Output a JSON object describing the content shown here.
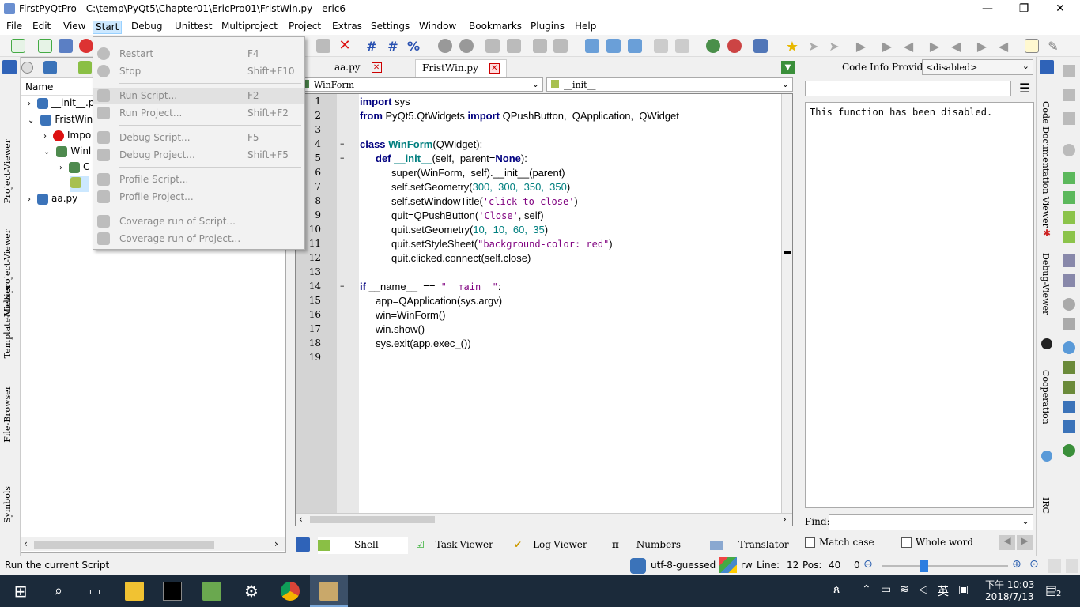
{
  "window": {
    "title": "FirstPyQtPro - C:\\temp\\PyQt5\\Chapter01\\EricPro01\\FristWin.py - eric6"
  },
  "menubar": [
    "File",
    "Edit",
    "View",
    "Start",
    "Debug",
    "Unittest",
    "Multiproject",
    "Project",
    "Extras",
    "Settings",
    "Window",
    "Bookmarks",
    "Plugins",
    "Help"
  ],
  "start_menu": [
    {
      "label": "Restart",
      "shortcut": "F4"
    },
    {
      "label": "Stop",
      "shortcut": "Shift+F10"
    },
    {
      "label": "Run Script...",
      "shortcut": "F2"
    },
    {
      "label": "Run Project...",
      "shortcut": "Shift+F2"
    },
    {
      "label": "Debug Script...",
      "shortcut": "F5"
    },
    {
      "label": "Debug Project...",
      "shortcut": "Shift+F5"
    },
    {
      "label": "Profile Script...",
      "shortcut": ""
    },
    {
      "label": "Profile Project...",
      "shortcut": ""
    },
    {
      "label": "Coverage run of Script...",
      "shortcut": ""
    },
    {
      "label": "Coverage run of Project...",
      "shortcut": ""
    }
  ],
  "left_vtabs": [
    "Project-Viewer",
    "Multiproject-Viewer",
    "Template-Viewer",
    "File-Browser",
    "Symbols"
  ],
  "project": {
    "header": "Name",
    "rows": [
      "__init__.p",
      "FristWin",
      "Impo",
      "Winl",
      "C",
      "_",
      "aa.py"
    ]
  },
  "editor_tabs": [
    "aa.py",
    "FristWin.py"
  ],
  "class_combo": "WinForm",
  "method_combo": "__init__",
  "code_lines": [
    {
      "n": "1",
      "fold": ""
    },
    {
      "n": "2",
      "fold": ""
    },
    {
      "n": "3",
      "fold": ""
    },
    {
      "n": "4",
      "fold": "–"
    },
    {
      "n": "5",
      "fold": "–"
    },
    {
      "n": "6",
      "fold": ""
    },
    {
      "n": "7",
      "fold": ""
    },
    {
      "n": "8",
      "fold": ""
    },
    {
      "n": "9",
      "fold": ""
    },
    {
      "n": "10",
      "fold": ""
    },
    {
      "n": "11",
      "fold": ""
    },
    {
      "n": "12",
      "fold": ""
    },
    {
      "n": "13",
      "fold": ""
    },
    {
      "n": "14",
      "fold": "–"
    },
    {
      "n": "15",
      "fold": ""
    },
    {
      "n": "16",
      "fold": ""
    },
    {
      "n": "17",
      "fold": ""
    },
    {
      "n": "18",
      "fold": ""
    },
    {
      "n": "19",
      "fold": ""
    }
  ],
  "code": {
    "l1a": "import",
    "l1b": " sys",
    "l2a": "from",
    "l2b": " PyQt5.QtWidgets ",
    "l2c": "import",
    "l2d": " QPushButton,  QApplication,  QWidget",
    "l4a": "class",
    "l4b": " WinForm",
    "l4c": "(QWidget):",
    "l5a": "def",
    "l5b": " __init__",
    "l5c": "(self,  parent=",
    "l5d": "None",
    "l5e": "):",
    "l6": "super(WinForm,  self).__init__(parent)",
    "l7a": "self.setGeometry(",
    "l7b": "300,  300,  350,  350",
    "l7c": ")",
    "l8a": "self.setWindowTitle(",
    "l8b": "'click to close'",
    "l8c": ")",
    "l9a": "quit=QPushButton(",
    "l9b": "'Close'",
    "l9c": ", self)",
    "l10a": "quit.setGeometry(",
    "l10b": "10,  10,  60,  35",
    "l10c": ")",
    "l11a": "quit.setStyleSheet(",
    "l11b": "\"background-color: red\"",
    "l11c": ")",
    "l12": "quit.clicked.connect(self.close)",
    "l14a": "if",
    "l14b": " __name__  ==  ",
    "l14c": "\"__main__\"",
    "l14d": ":",
    "l15": "app=QApplication(sys.argv)",
    "l16": "win=WinForm()",
    "l17": "win.show()",
    "l18": "sys.exit(app.exec_())"
  },
  "bottom_tabs": [
    "Shell",
    "Task-Viewer",
    "Log-Viewer",
    "Numbers",
    "Translator"
  ],
  "right": {
    "provider_label": "Code Info Provider:",
    "provider_value": "<disabled>",
    "message": "This function has been disabled.",
    "find_label": "Find:",
    "match_case": "Match case",
    "whole_word": "Whole word"
  },
  "right_vtabs": [
    "Code Documentation Viewer",
    "Debug-Viewer",
    "Cooperation",
    "IRC"
  ],
  "status": {
    "message": "Run the current Script",
    "encoding": "utf-8-guessed",
    "rw": "rw",
    "line_label": "Line:",
    "line": "12",
    "pos_label": "Pos:",
    "pos": "40",
    "zoom": "0"
  },
  "taskbar": {
    "ime": "英",
    "time": "下午 10:03",
    "date": "2018/7/13",
    "notifications": "2"
  },
  "colors": {
    "keyword": "#00007f",
    "function": "#007f7f",
    "number": "#007f7f",
    "string": "#7f007f",
    "menu_hl": "#cce8ff",
    "taskbar": "#1b2a3a"
  }
}
